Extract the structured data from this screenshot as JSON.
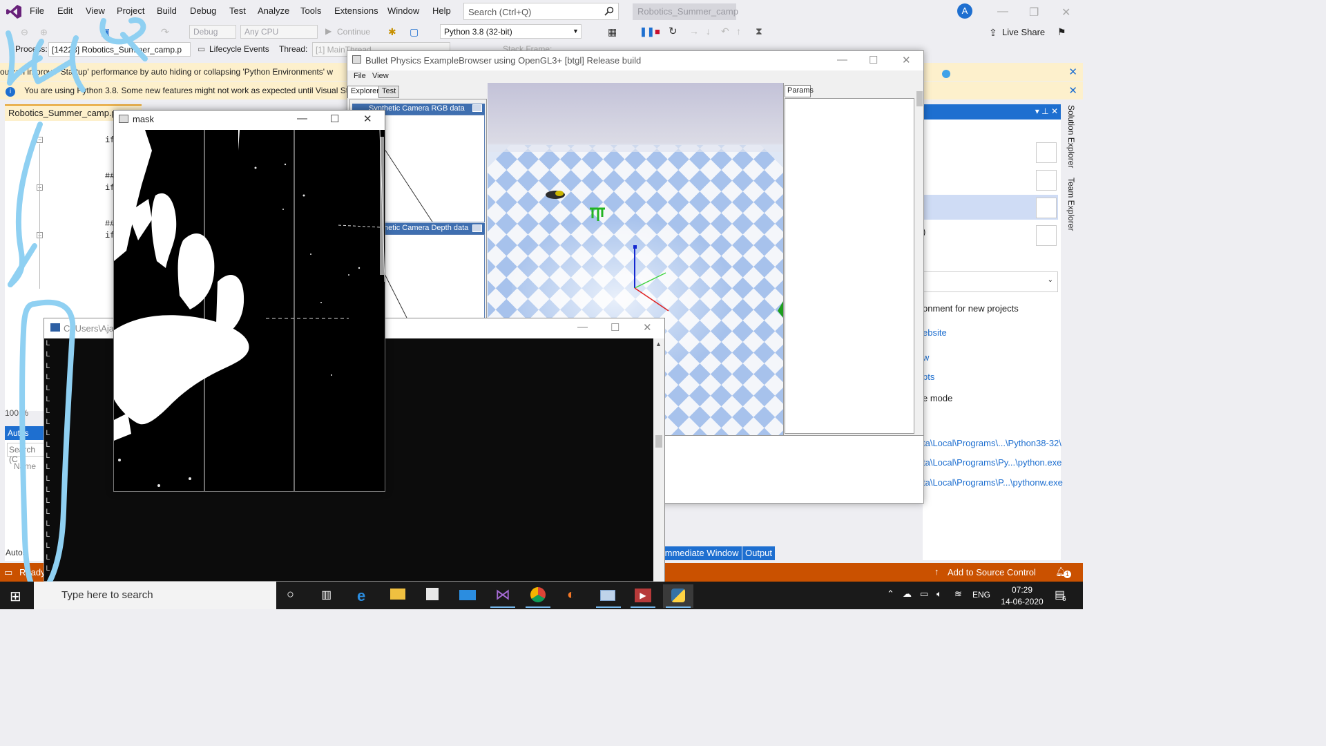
{
  "vs": {
    "menu": [
      "File",
      "Edit",
      "View",
      "Project",
      "Build",
      "Debug",
      "Test",
      "Analyze",
      "Tools",
      "Extensions",
      "Window",
      "Help"
    ],
    "search_placeholder": "Search (Ctrl+Q)",
    "solution_title": "Robotics_Summer_camp",
    "avatar_letter": "A",
    "toolbar": {
      "config": "Debug",
      "platform": "Any CPU",
      "continue_label": "Continue",
      "python_env": "Python 3.8 (32-bit)",
      "live_share": "Live Share"
    },
    "debugbar": {
      "process_label": "Process:",
      "process_value": "[14228] Robotics_Summer_camp.p",
      "lifecycle_label": "Lifecycle Events",
      "thread_label": "Thread:",
      "thread_value": "[1] MainThread",
      "stackframe_label": "Stack Frame:"
    },
    "infobars": [
      "ou can improve 'Startup' performance by auto hiding or collapsing 'Python Environments' w",
      "You are using Python 3.8. Some new features might not work as expected until Visual Stud"
    ],
    "editor": {
      "tab_label": "Robotics_Summer_camp.py",
      "lines": [
        "if",
        "##",
        "if",
        "##",
        "if"
      ],
      "zoom": "100 %"
    },
    "autos": {
      "title": "Autos",
      "search_placeholder": "Search (C",
      "name_header": "Name",
      "tab": "Autos"
    },
    "solution_explorer": {
      "items": [
        "onment for new projects",
        "ebsite",
        "w",
        "pts",
        "e mode",
        "ta\\Local\\Programs\\...\\Python38-32\\",
        "ta\\Local\\Programs\\Py...\\python.exe",
        "ta\\Local\\Programs\\P...\\pythonw.exe"
      ],
      "side_tabs": [
        "Solution Explorer",
        "Team Explorer"
      ]
    },
    "bottom_tabs": [
      "Immediate Window",
      "Output"
    ],
    "status": {
      "ready": "Ready",
      "source_control": "Add to Source Control",
      "notifications": "1"
    }
  },
  "bullet": {
    "title": "Bullet Physics ExampleBrowser using OpenGL3+ [btgl] Release build",
    "menu": [
      "File",
      "View"
    ],
    "tabs": [
      "Explorer",
      "Test"
    ],
    "rgb_panel": "Synthetic Camera RGB data",
    "depth_panel": "Synthetic Camera Depth data",
    "params_tab": "Params"
  },
  "console": {
    "title": "C:\\Users\\Ajas",
    "glyph": "L"
  },
  "mask": {
    "title": "mask"
  },
  "taskbar": {
    "search_placeholder": "Type here to search",
    "language": "ENG",
    "time": "07:29",
    "date": "14-06-2020",
    "notification_count": "6"
  },
  "colors": {
    "vs_accent": "#1e6fd0",
    "status_debug": "#ca5100",
    "infobar": "#fdf0cc",
    "annotation_stroke": "#8fd0f2",
    "sky": "#c9c8dc",
    "floor_tile": "#a9c4ee"
  }
}
